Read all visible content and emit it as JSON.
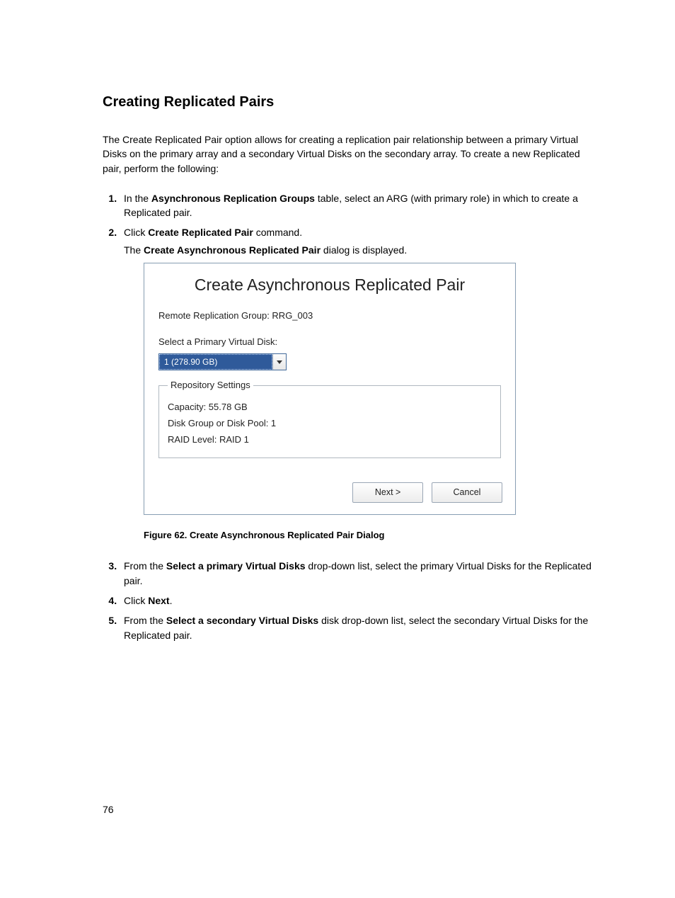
{
  "section_title": "Creating Replicated Pairs",
  "intro": "The Create Replicated Pair option allows for creating a replication pair relationship between a primary Virtual Disks on the primary array and a secondary Virtual Disks on the secondary array. To create a new Replicated pair, perform the following:",
  "steps": {
    "s1_pre": "In the ",
    "s1_bold": "Asynchronous Replication Groups",
    "s1_post": " table, select an ARG (with primary role) in which to create a Replicated pair.",
    "s2_pre": "Click ",
    "s2_bold": "Create Replicated Pair",
    "s2_post": " command.",
    "s2_sub_pre": "The ",
    "s2_sub_bold": "Create Asynchronous Replicated Pair",
    "s2_sub_post": " dialog is displayed.",
    "s3_pre": "From the ",
    "s3_bold": "Select a primary Virtual Disks",
    "s3_post": " drop-down list, select the primary Virtual Disks for the Replicated pair.",
    "s4_pre": "Click ",
    "s4_bold": "Next",
    "s4_post": ".",
    "s5_pre": "From the ",
    "s5_bold": "Select a secondary Virtual Disks",
    "s5_post": " disk drop-down list, select the secondary Virtual Disks for the Replicated pair."
  },
  "dialog": {
    "title": "Create Asynchronous Replicated Pair",
    "remote_group_label": "Remote Replication Group: RRG_003",
    "select_primary_label": "Select a Primary Virtual Disk:",
    "selected_value": "1 (278.90 GB)",
    "repo_legend": "Repository Settings",
    "capacity": "Capacity:  55.78 GB",
    "diskgroup": "Disk Group or Disk Pool:  1",
    "raid": "RAID Level:  RAID 1",
    "next_btn": "Next >",
    "cancel_btn": "Cancel"
  },
  "figure_caption": "Figure 62. Create Asynchronous Replicated Pair Dialog",
  "page_number": "76"
}
